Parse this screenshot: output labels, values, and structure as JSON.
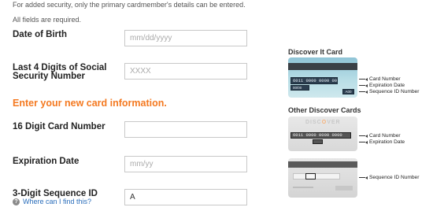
{
  "intro_text": "For added security, only the primary cardmember's details can be entered.",
  "required_text": "All fields are required.",
  "form": {
    "dob": {
      "label": "Date of Birth",
      "placeholder": "mm/dd/yyyy",
      "value": ""
    },
    "ssn": {
      "label_line1": "Last 4 Digits of Social",
      "label_line2": "Security Number",
      "placeholder": "XXXX",
      "value": ""
    },
    "section_title": "Enter your new card information.",
    "card_number": {
      "label": "16 Digit Card Number",
      "placeholder": "",
      "value": ""
    },
    "expiration": {
      "label": "Expiration Date",
      "placeholder": "mm/yy",
      "value": ""
    },
    "sequence": {
      "label": "3-Digit Sequence ID",
      "placeholder": "",
      "value": "A"
    },
    "help_icon": "?",
    "help_link": "Where can I find this?"
  },
  "cards": {
    "discover_it": {
      "heading": "Discover It Card",
      "number_sample": "6011 0000 0000 0000",
      "exp_sample": "00/00",
      "seq_sample": "A00",
      "callouts": [
        "Card Number",
        "Expiration Date",
        "Sequence ID Number"
      ]
    },
    "other": {
      "heading": "Other Discover Cards",
      "brand": "DISCOVER",
      "front_callouts": [
        "Card Number",
        "Expiration Date"
      ],
      "back_callouts": [
        "Sequence ID Number"
      ]
    }
  },
  "colors": {
    "accent_orange": "#f47920",
    "link_blue": "#2a6ebb"
  }
}
